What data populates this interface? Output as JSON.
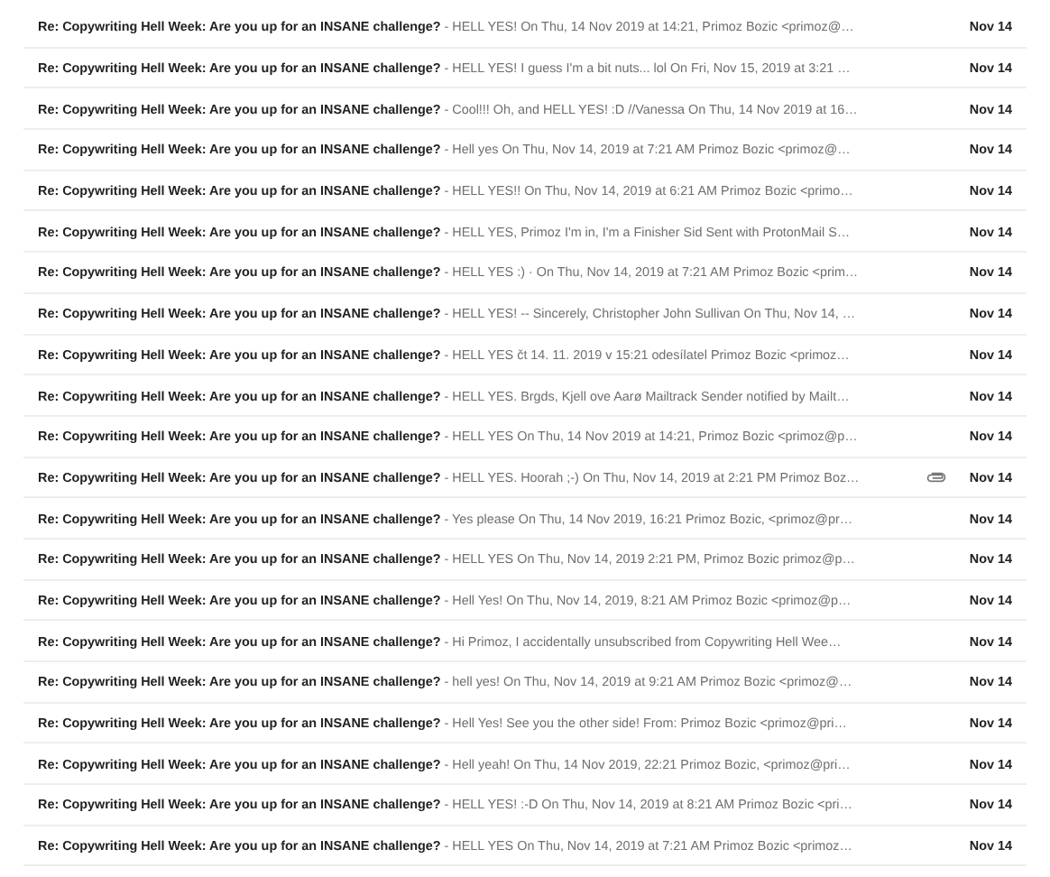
{
  "emails": [
    {
      "subject": "Re: Copywriting Hell Week: Are you up for an INSANE challenge?",
      "snippet": "- HELL YES! On Thu, 14 Nov 2019 at 14:21, Primoz Bozic <primoz@…",
      "attachment": false,
      "date": "Nov 14"
    },
    {
      "subject": "Re: Copywriting Hell Week: Are you up for an INSANE challenge?",
      "snippet": "- HELL YES! I guess I'm a bit nuts... lol On Fri, Nov 15, 2019 at 3:21 …",
      "attachment": false,
      "date": "Nov 14"
    },
    {
      "subject": "Re: Copywriting Hell Week: Are you up for an INSANE challenge?",
      "snippet": "- Cool!!! Oh, and HELL YES! :D //Vanessa On Thu, 14 Nov 2019 at 16…",
      "attachment": false,
      "date": "Nov 14"
    },
    {
      "subject": "Re: Copywriting Hell Week: Are you up for an INSANE challenge?",
      "snippet": "- Hell yes On Thu, Nov 14, 2019 at 7:21 AM Primoz Bozic <primoz@…",
      "attachment": false,
      "date": "Nov 14"
    },
    {
      "subject": "Re: Copywriting Hell Week: Are you up for an INSANE challenge?",
      "snippet": "- HELL YES!! On Thu, Nov 14, 2019 at 6:21 AM Primoz Bozic <primo…",
      "attachment": false,
      "date": "Nov 14"
    },
    {
      "subject": "Re: Copywriting Hell Week: Are you up for an INSANE challenge?",
      "snippet": "- HELL YES, Primoz I'm in, I'm a Finisher Sid Sent with ProtonMail S…",
      "attachment": false,
      "date": "Nov 14"
    },
    {
      "subject": "Re: Copywriting Hell Week: Are you up for an INSANE challenge?",
      "snippet": "- HELL YES :) · On Thu, Nov 14, 2019 at 7:21 AM Primoz Bozic <prim…",
      "attachment": false,
      "date": "Nov 14"
    },
    {
      "subject": "Re: Copywriting Hell Week: Are you up for an INSANE challenge?",
      "snippet": "- HELL YES! -- Sincerely, Christopher John Sullivan On Thu, Nov 14, …",
      "attachment": false,
      "date": "Nov 14"
    },
    {
      "subject": "Re: Copywriting Hell Week: Are you up for an INSANE challenge?",
      "snippet": "- HELL YES čt 14. 11. 2019 v 15:21 odesílatel Primoz Bozic <primoz…",
      "attachment": false,
      "date": "Nov 14"
    },
    {
      "subject": "Re: Copywriting Hell Week: Are you up for an INSANE challenge?",
      "snippet": "- HELL YES. Brgds, Kjell ove Aarø Mailtrack Sender notified by Mailt…",
      "attachment": false,
      "date": "Nov 14"
    },
    {
      "subject": "Re: Copywriting Hell Week: Are you up for an INSANE challenge?",
      "snippet": "- HELL YES On Thu, 14 Nov 2019 at 14:21, Primoz Bozic <primoz@p…",
      "attachment": false,
      "date": "Nov 14"
    },
    {
      "subject": "Re: Copywriting Hell Week: Are you up for an INSANE challenge?",
      "snippet": "- HELL YES. Hoorah ;-) On Thu, Nov 14, 2019 at 2:21 PM Primoz Boz…",
      "attachment": true,
      "date": "Nov 14"
    },
    {
      "subject": "Re: Copywriting Hell Week: Are you up for an INSANE challenge?",
      "snippet": "- Yes please On Thu, 14 Nov 2019, 16:21 Primoz Bozic, <primoz@pr…",
      "attachment": false,
      "date": "Nov 14"
    },
    {
      "subject": "Re: Copywriting Hell Week: Are you up for an INSANE challenge?",
      "snippet": "- HELL YES On Thu, Nov 14, 2019 2:21 PM, Primoz Bozic primoz@p…",
      "attachment": false,
      "date": "Nov 14"
    },
    {
      "subject": "Re: Copywriting Hell Week: Are you up for an INSANE challenge?",
      "snippet": "- Hell Yes! On Thu, Nov 14, 2019, 8:21 AM Primoz Bozic <primoz@p…",
      "attachment": false,
      "date": "Nov 14"
    },
    {
      "subject": "Re: Copywriting Hell Week: Are you up for an INSANE challenge?",
      "snippet": "- Hi Primoz, I accidentally unsubscribed from Copywriting Hell Wee…",
      "attachment": false,
      "date": "Nov 14"
    },
    {
      "subject": "Re: Copywriting Hell Week: Are you up for an INSANE challenge?",
      "snippet": "- hell yes! On Thu, Nov 14, 2019 at 9:21 AM Primoz Bozic <primoz@…",
      "attachment": false,
      "date": "Nov 14"
    },
    {
      "subject": "Re: Copywriting Hell Week: Are you up for an INSANE challenge?",
      "snippet": "- Hell Yes! See you the other side! From: Primoz Bozic <primoz@pri…",
      "attachment": false,
      "date": "Nov 14"
    },
    {
      "subject": "Re: Copywriting Hell Week: Are you up for an INSANE challenge?",
      "snippet": "- Hell yeah! On Thu, 14 Nov 2019, 22:21 Primoz Bozic, <primoz@pri…",
      "attachment": false,
      "date": "Nov 14"
    },
    {
      "subject": "Re: Copywriting Hell Week: Are you up for an INSANE challenge?",
      "snippet": "- HELL YES! :-D On Thu, Nov 14, 2019 at 8:21 AM Primoz Bozic <pri…",
      "attachment": false,
      "date": "Nov 14"
    },
    {
      "subject": "Re: Copywriting Hell Week: Are you up for an INSANE challenge?",
      "snippet": "- HELL YES On Thu, Nov 14, 2019 at 7:21 AM Primoz Bozic <primoz…",
      "attachment": false,
      "date": "Nov 14"
    }
  ]
}
